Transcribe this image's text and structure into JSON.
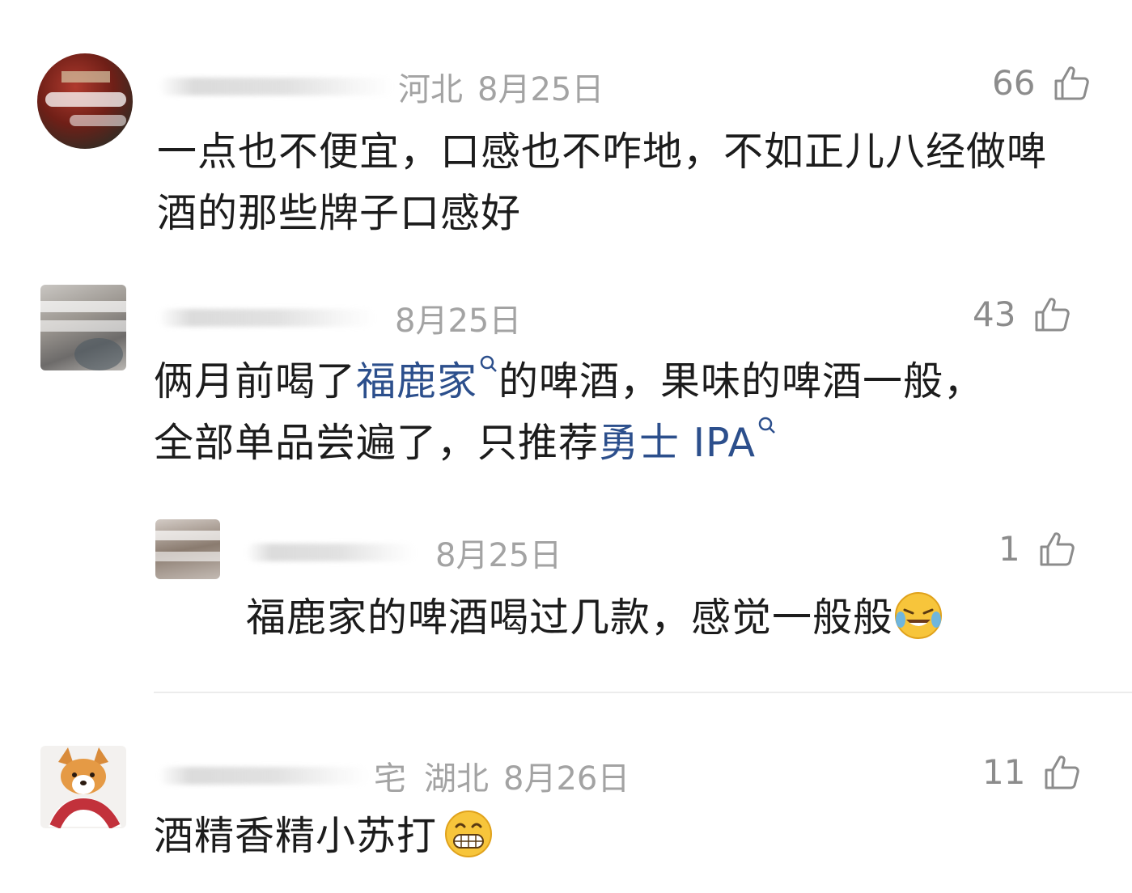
{
  "comments": [
    {
      "region": "河北",
      "date": "8月25日",
      "likes": "66",
      "text": "一点也不便宜，口感也不咋地，不如正儿八经做啤酒的那些牌子口感好"
    },
    {
      "region": "",
      "date": "8月25日",
      "likes": "43",
      "text_part1": "俩月前喝了",
      "link1": "福鹿家",
      "text_part2": "的啤酒，果味的啤酒一般，",
      "text_part3": "全部单品尝遍了，只推荐",
      "link2": "勇士 IPA"
    },
    {
      "region": "",
      "date": "8月25日",
      "likes": "1",
      "text": "福鹿家的啤酒喝过几款，感觉一般般",
      "emoji": "laughing-crying-emoji"
    },
    {
      "name_suffix": "宅",
      "region": "湖北",
      "date": "8月26日",
      "likes": "11",
      "text": "酒精香精小苏打",
      "emoji": "grinning-emoji"
    }
  ],
  "colors": {
    "link": "#2c4f8c",
    "meta": "#9a9a9a",
    "text": "#1c1c1c"
  }
}
